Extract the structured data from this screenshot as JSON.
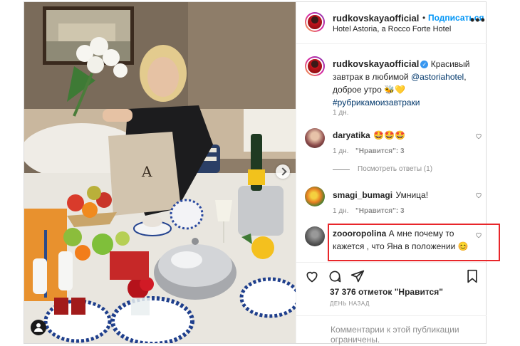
{
  "post": {
    "username": "rudkovskayaofficial",
    "follow_dot": "•",
    "follow_label": "Подписаться",
    "location": "Hotel Astoria, a Rocco Forte Hotel",
    "more_icon": "more-horizontal-icon"
  },
  "caption": {
    "username": "rudkovskayaofficial",
    "verified_glyph": "✓",
    "text_before": "Красивый завтрак в любимой",
    "mention": "@astoriahotel",
    "text_after": ", доброе утро 🐝💛",
    "hashtag": "#рубрикамоизавтраки",
    "time": "1 дн."
  },
  "comments": [
    {
      "username": "daryatika",
      "text": "🤩🤩🤩",
      "time": "1 дн.",
      "likes_label": "\"Нравится\": 3",
      "view_replies": "Посмотреть ответы (1)"
    },
    {
      "username": "smagi_bumagi",
      "text": "Умница!",
      "time": "1 дн.",
      "likes_label": "\"Нравится\": 3"
    },
    {
      "username": "zoooropolina",
      "text": "А мне почему то кажется , что Яна в положении 😊"
    }
  ],
  "actions": {
    "likes_count": "37 376 отметок \"Нравится\"",
    "posted_when": "ДЕНЬ НАЗАД"
  },
  "footer": {
    "comments_disabled": "Комментарии к этой публикации ограничены."
  },
  "colors": {
    "link_blue": "#0095f6",
    "mention_color": "#00376b",
    "highlight_red": "#e8262a",
    "meta_gray": "#8e8e8e"
  }
}
